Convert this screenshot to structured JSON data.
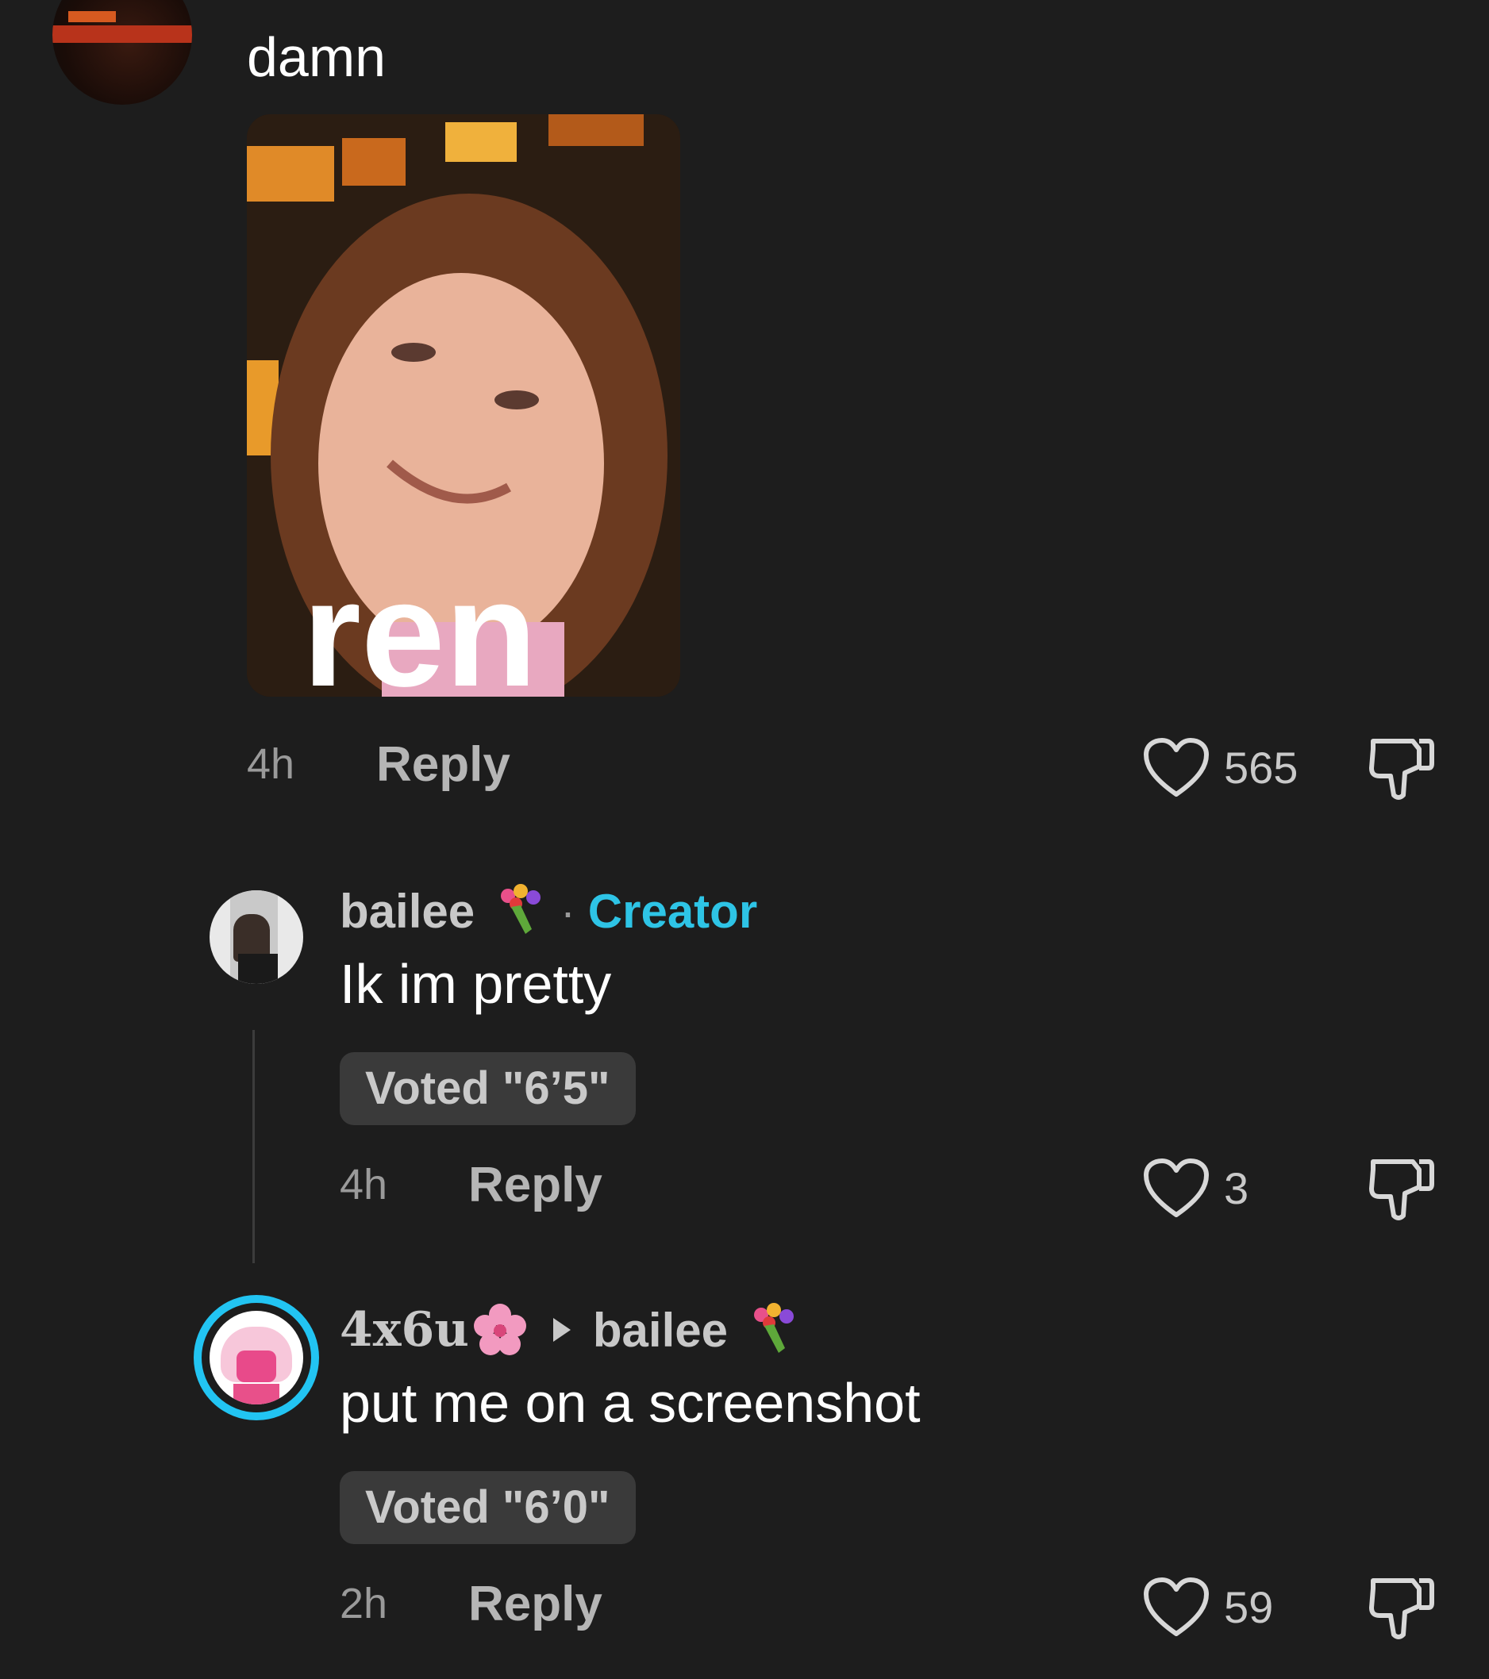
{
  "comment1": {
    "text": "damn",
    "time": "4h",
    "reply_label": "Reply",
    "like_count": "565",
    "image_overlay_text": "ren"
  },
  "comment2": {
    "username": "bailee",
    "separator": "·",
    "creator_label": "Creator",
    "text": "Ik im pretty",
    "vote_text": "Voted \"6’5\"",
    "time": "4h",
    "reply_label": "Reply",
    "like_count": "3"
  },
  "comment3": {
    "username": "4x6u",
    "reply_to": "bailee",
    "text": "put me on a screenshot",
    "vote_text": "Voted \"6’0\"",
    "time": "2h",
    "reply_label": "Reply",
    "like_count": "59"
  },
  "icons": {
    "like": "heart-outline-icon",
    "dislike": "thumbs-down-icon",
    "reply_arrow": "triangle-right-icon",
    "flower_emoji": "bouquet-emoji",
    "blossom_emoji": "cherry-blossom-emoji"
  },
  "colors": {
    "background": "#1d1d1d",
    "creator": "#2ec4e6",
    "avatar_ring": "#22c4f2"
  }
}
